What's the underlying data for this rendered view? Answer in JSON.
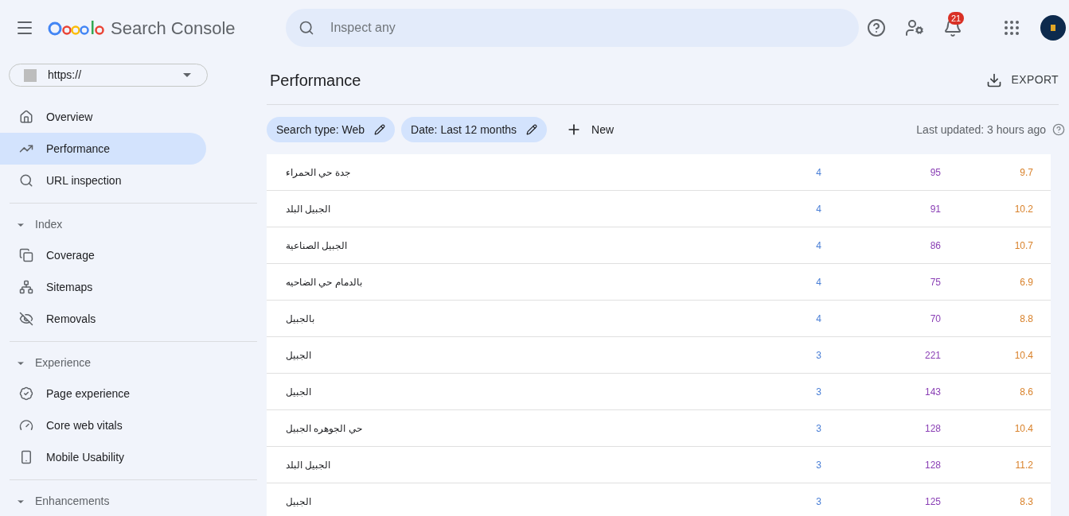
{
  "header": {
    "product": "Search Console",
    "search": {
      "placeholder": "Inspect any"
    },
    "notifications": "21"
  },
  "property": {
    "value": "https://"
  },
  "sidebar": {
    "items": [
      {
        "kind": "link",
        "label": "Overview",
        "selected": false
      },
      {
        "kind": "link",
        "label": "Performance",
        "selected": true
      },
      {
        "kind": "link",
        "label": "URL inspection",
        "selected": false
      },
      {
        "kind": "section",
        "label": "Index",
        "expanded": true
      },
      {
        "kind": "link",
        "label": "Coverage",
        "selected": false
      },
      {
        "kind": "link",
        "label": "Sitemaps",
        "selected": false
      },
      {
        "kind": "link",
        "label": "Removals",
        "selected": false
      },
      {
        "kind": "section",
        "label": "Experience",
        "expanded": true
      },
      {
        "kind": "link",
        "label": "Page experience",
        "selected": false
      },
      {
        "kind": "link",
        "label": "Core web vitals",
        "selected": false
      },
      {
        "kind": "link",
        "label": "Mobile Usability",
        "selected": false
      },
      {
        "kind": "section",
        "label": "Enhancements",
        "expanded": true
      }
    ]
  },
  "page": {
    "title": "Performance",
    "export": "EXPORT"
  },
  "filters": [
    {
      "label": "Search type: Web"
    },
    {
      "label": "Date: Last 12 months"
    }
  ],
  "new_button": "New",
  "last_updated": "Last updated: 3 hours ago",
  "table": {
    "rows": [
      [
        "جدة حي الحمراء",
        "4",
        "95",
        "9.7"
      ],
      [
        "الجبيل البلد",
        "4",
        "91",
        "10.2"
      ],
      [
        "الجبيل الصناعية",
        "4",
        "86",
        "10.7"
      ],
      [
        "بالدمام حي الضاحيه",
        "4",
        "75",
        "6.9"
      ],
      [
        "بالجبيل",
        "4",
        "70",
        "8.8"
      ],
      [
        "الجبيل",
        "3",
        "221",
        "10.4"
      ],
      [
        "الجبيل",
        "3",
        "143",
        "8.6"
      ],
      [
        "حي الجوهره الجبيل",
        "3",
        "128",
        "10.4"
      ],
      [
        "الجبيل البلد",
        "3",
        "128",
        "11.2"
      ],
      [
        "الجبيل",
        "3",
        "125",
        "8.3"
      ]
    ]
  }
}
